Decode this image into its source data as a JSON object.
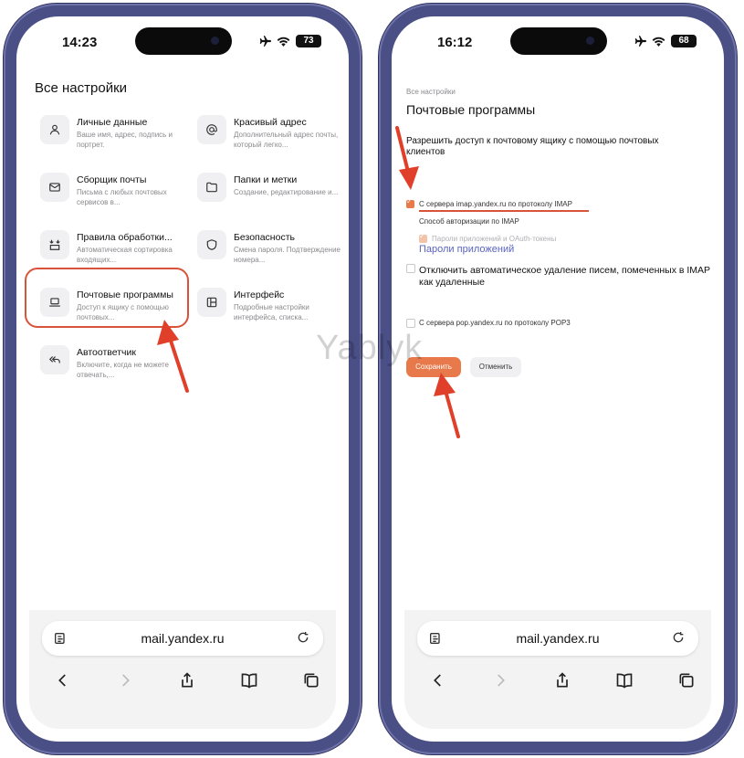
{
  "left": {
    "time": "14:23",
    "battery": "73",
    "page_title": "Все настройки",
    "items": [
      {
        "icon": "user-icon",
        "title": "Личные данные",
        "desc": "Ваше имя, адрес, подпись и портрет."
      },
      {
        "icon": "at-icon",
        "title": "Красивый адрес",
        "desc": "Дополнительный адрес почты, который легко..."
      },
      {
        "icon": "envelope-icon",
        "title": "Сборщик почты",
        "desc": "Письма с любых почтовых сервисов в..."
      },
      {
        "icon": "folder-icon",
        "title": "Папки и метки",
        "desc": "Создание, редактирование и..."
      },
      {
        "icon": "rules-icon",
        "title": "Правила обработки...",
        "desc": "Автоматическая сортировка входящих..."
      },
      {
        "icon": "shield-icon",
        "title": "Безопасность",
        "desc": "Смена пароля. Подтверждение номера..."
      },
      {
        "icon": "laptop-icon",
        "title": "Почтовые программы",
        "desc": "Доступ к ящику с помощью почтовых..."
      },
      {
        "icon": "layout-icon",
        "title": "Интерфейс",
        "desc": "Подробные настройки интерфейса, списка..."
      },
      {
        "icon": "reply-all-icon",
        "title": "Автоответчик",
        "desc": "Включите, когда не можете отвечать,..."
      }
    ]
  },
  "right": {
    "time": "16:12",
    "battery": "68",
    "breadcrumb": "Все настройки",
    "page_title": "Почтовые программы",
    "section_label": "Разрешить доступ к почтовому ящику с помощью почтовых клиентов",
    "imap_label": "С сервера imap.yandex.ru по протоколу IMAP",
    "imap_checked": true,
    "auth_method": "Способ авторизации по IMAP",
    "app_passwords_oauth": "Пароли приложений и OAuth-токены",
    "app_passwords_link": "Пароли приложений",
    "disable_autodelete": "Отключить автоматическое удаление писем, помеченных в IMAP как удаленные",
    "pop3_label": "С сервера pop.yandex.ru по протоколу POP3",
    "save_button": "Сохранить",
    "cancel_button": "Отменить"
  },
  "browser": {
    "url": "mail.yandex.ru"
  },
  "watermark": "Yablyk",
  "colors": {
    "accent": "#e8794a",
    "highlight": "#d9533b",
    "link": "#5963c2",
    "phone_frame": "#4a4f86"
  }
}
